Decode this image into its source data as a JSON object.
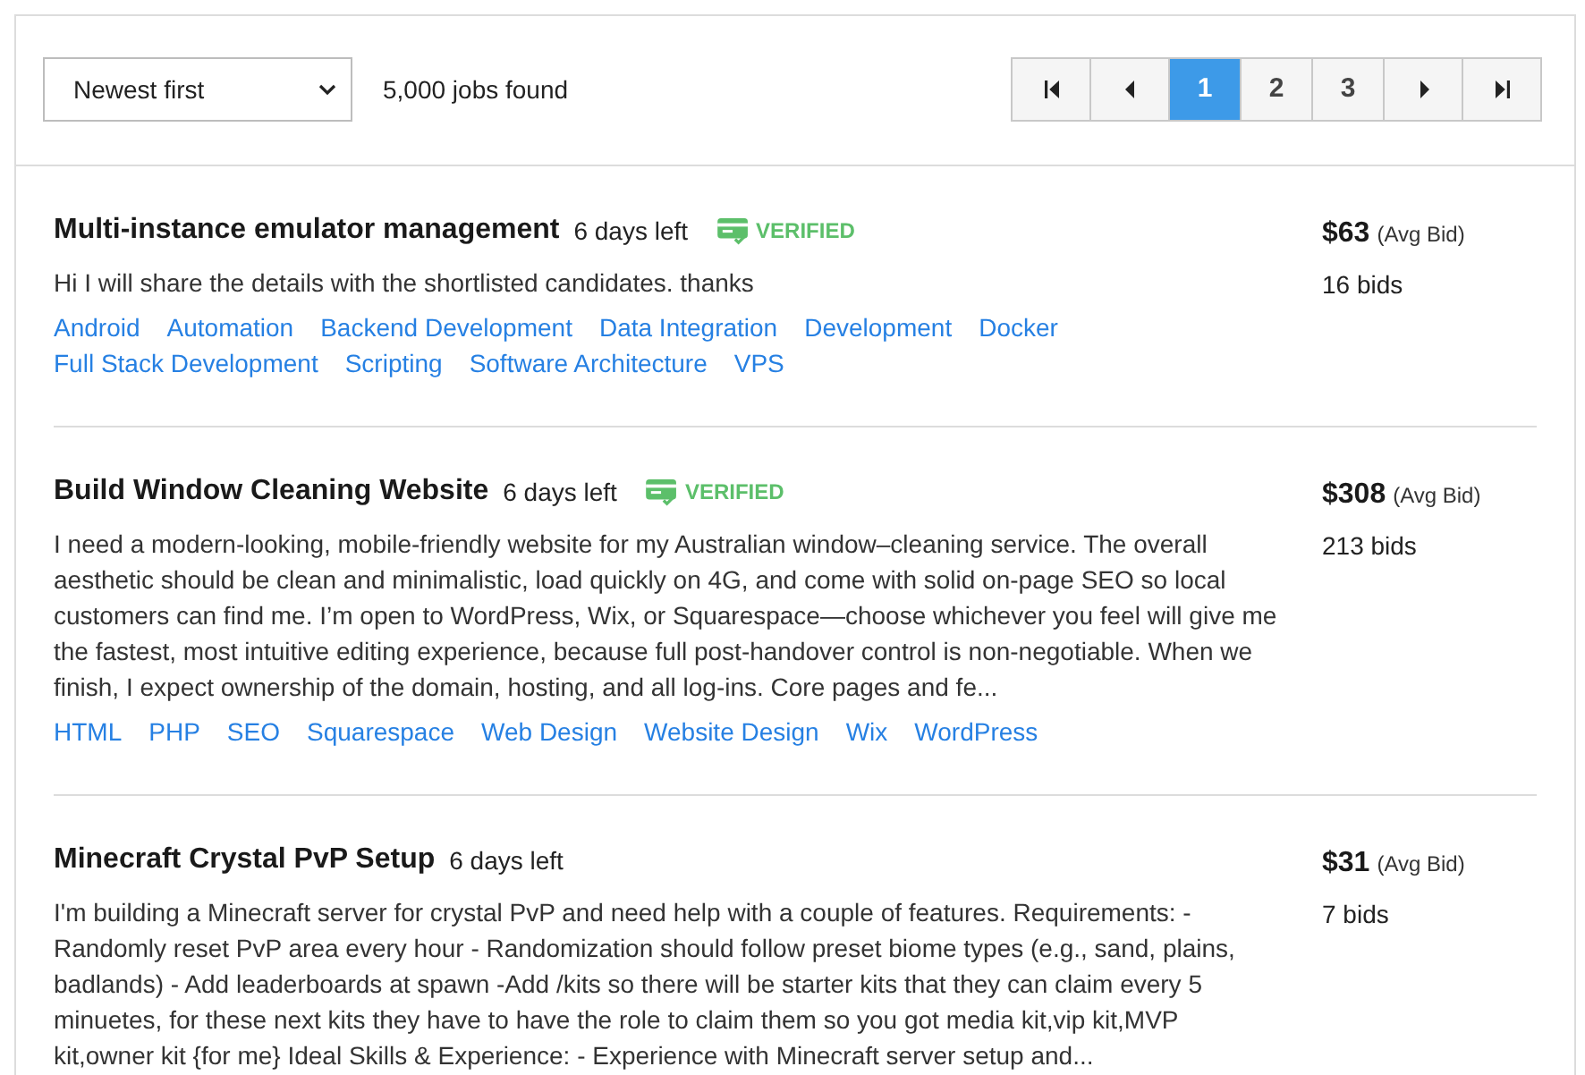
{
  "toolbar": {
    "sort": {
      "value": "Newest first"
    },
    "result_count": "5,000 jobs found"
  },
  "pagination": [
    {
      "kind": "first",
      "selected": false
    },
    {
      "kind": "prev",
      "selected": false
    },
    {
      "kind": "page",
      "label": "1",
      "selected": true
    },
    {
      "kind": "page",
      "label": "2",
      "selected": false
    },
    {
      "kind": "page",
      "label": "3",
      "selected": false
    },
    {
      "kind": "next",
      "selected": false
    },
    {
      "kind": "last",
      "selected": false
    }
  ],
  "jobs": [
    {
      "title": "Multi-instance emulator management",
      "time_left": "6 days left",
      "verified": true,
      "verified_label": "VERIFIED",
      "description": "Hi I will share the details with the shortlisted candidates. thanks",
      "tags": [
        "Android",
        "Automation",
        "Backend Development",
        "Data Integration",
        "Development",
        "Docker",
        "Full Stack Development",
        "Scripting",
        "Software Architecture",
        "VPS"
      ],
      "avg_bid": "$63",
      "avg_bid_label": "(Avg Bid)",
      "bids": "16 bids"
    },
    {
      "title": "Build Window Cleaning Website",
      "time_left": "6 days left",
      "verified": true,
      "verified_label": "VERIFIED",
      "description": "I need a modern-looking, mobile-friendly website for my Australian window–cleaning service. The overall aesthetic should be clean and minimalistic, load quickly on 4G, and come with solid on-page SEO so local customers can find me. I’m open to WordPress, Wix, or Squarespace—choose whichever you feel will give me the fastest, most intuitive editing experience, because full post-handover control is non-negotiable. When we finish, I expect ownership of the domain, hosting, and all log-ins. Core pages and fe...",
      "tags": [
        "HTML",
        "PHP",
        "SEO",
        "Squarespace",
        "Web Design",
        "Website Design",
        "Wix",
        "WordPress"
      ],
      "avg_bid": "$308",
      "avg_bid_label": "(Avg Bid)",
      "bids": "213 bids"
    },
    {
      "title": "Minecraft Crystal PvP Setup",
      "time_left": "6 days left",
      "verified": false,
      "description": "I'm building a Minecraft server for crystal PvP and need help with a couple of features. Requirements: - Randomly reset PvP area every hour - Randomization should follow preset biome types (e.g., sand, plains, badlands) - Add leaderboards at spawn -Add /kits so there will be starter kits that they can claim every 5 minuetes, for these next kits they have to have the role to claim them so you got media kit,vip kit,MVP kit,owner kit {for me} Ideal Skills & Experience: - Experience with Minecraft server setup and...",
      "avg_bid": "$31",
      "avg_bid_label": "(Avg Bid)",
      "bids": "7 bids"
    }
  ]
}
